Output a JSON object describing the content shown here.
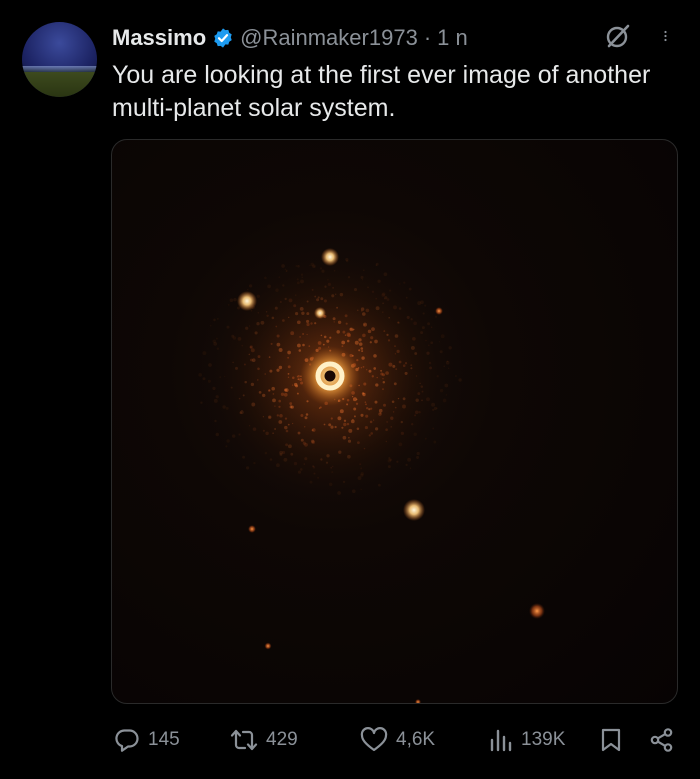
{
  "post": {
    "author_name": "Massimo",
    "author_handle": "@Rainmaker1973",
    "separator": "·",
    "timestamp": "1 n",
    "text": "You are looking at the first ever image of another multi-planet solar system."
  },
  "icons": {
    "avatar": "avatar-image",
    "verified": "verified-badge-icon",
    "grok": "grok-icon",
    "more": "more-options-icon",
    "reply": "reply-icon",
    "repost": "repost-icon",
    "like": "heart-icon",
    "views": "views-icon",
    "bookmark": "bookmark-icon",
    "share": "share-icon"
  },
  "metrics": {
    "replies": "145",
    "reposts": "429",
    "likes": "4,6K",
    "views": "139K"
  },
  "colors": {
    "background": "#000000",
    "text_primary": "#e7e9ea",
    "text_secondary": "#8b9198",
    "verified": "#1d9bf0",
    "star_glow": "#f0a040"
  }
}
